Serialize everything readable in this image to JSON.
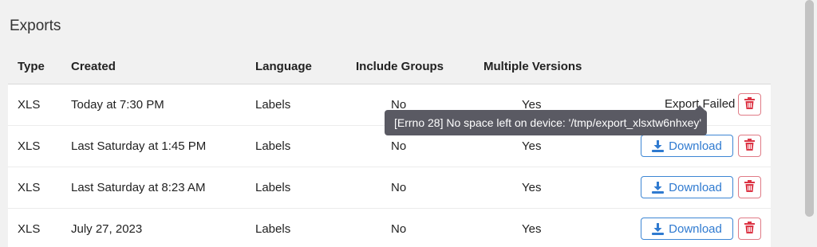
{
  "page": {
    "title": "Exports"
  },
  "table": {
    "headers": {
      "type": "Type",
      "created": "Created",
      "language": "Language",
      "include_groups": "Include Groups",
      "multiple_versions": "Multiple Versions"
    },
    "rows": [
      {
        "type": "XLS",
        "created": "Today at 7:30 PM",
        "language": "Labels",
        "include_groups": "No",
        "multiple_versions": "Yes",
        "status": "Export Failed"
      },
      {
        "type": "XLS",
        "created": "Last Saturday at 1:45 PM",
        "language": "Labels",
        "include_groups": "No",
        "multiple_versions": "Yes",
        "action_label": "Download"
      },
      {
        "type": "XLS",
        "created": "Last Saturday at 8:23 AM",
        "language": "Labels",
        "include_groups": "No",
        "multiple_versions": "Yes",
        "action_label": "Download"
      },
      {
        "type": "XLS",
        "created": "July 27, 2023",
        "language": "Labels",
        "include_groups": "No",
        "multiple_versions": "Yes",
        "action_label": "Download"
      }
    ]
  },
  "tooltip": {
    "text": "[Errno 28] No space left on device: '/tmp/export_xlsxtw6nhxey'"
  },
  "icons": {
    "download": "download-icon",
    "delete": "trash-icon"
  },
  "colors": {
    "primary": "#2f7ad0",
    "danger": "#dc3545",
    "tooltip_bg": "#5a5a63",
    "page_bg": "#f1f1f1"
  }
}
